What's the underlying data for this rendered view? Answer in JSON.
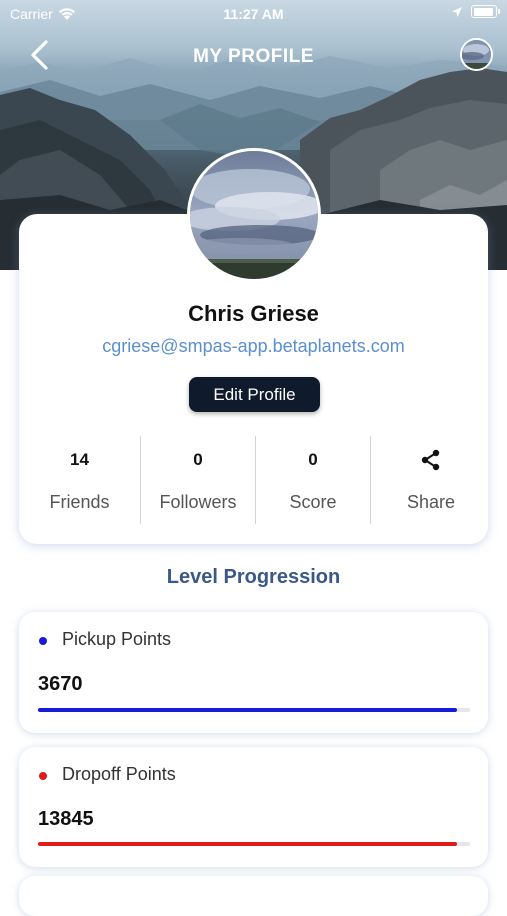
{
  "status_bar": {
    "carrier": "Carrier",
    "time": "11:27 AM"
  },
  "nav": {
    "title": "MY PROFILE"
  },
  "profile": {
    "name": "Chris Griese",
    "email": "cgriese@smpas-app.betaplanets.com",
    "edit_label": "Edit Profile"
  },
  "stats": [
    {
      "value": "14",
      "label": "Friends"
    },
    {
      "value": "0",
      "label": "Followers"
    },
    {
      "value": "0",
      "label": "Score"
    },
    {
      "icon": "share-icon",
      "label": "Share"
    }
  ],
  "level": {
    "title": "Level Progression",
    "items": [
      {
        "label": "Pickup Points",
        "value": "3670",
        "color": "#1a1adb",
        "progress": 0.97
      },
      {
        "label": "Dropoff Points",
        "value": "13845",
        "color": "#e01b1b",
        "progress": 0.97
      }
    ]
  },
  "colors": {
    "accent_dark": "#0f1a2c",
    "email_link": "#5b8fd0",
    "section_title": "#3a5888"
  }
}
